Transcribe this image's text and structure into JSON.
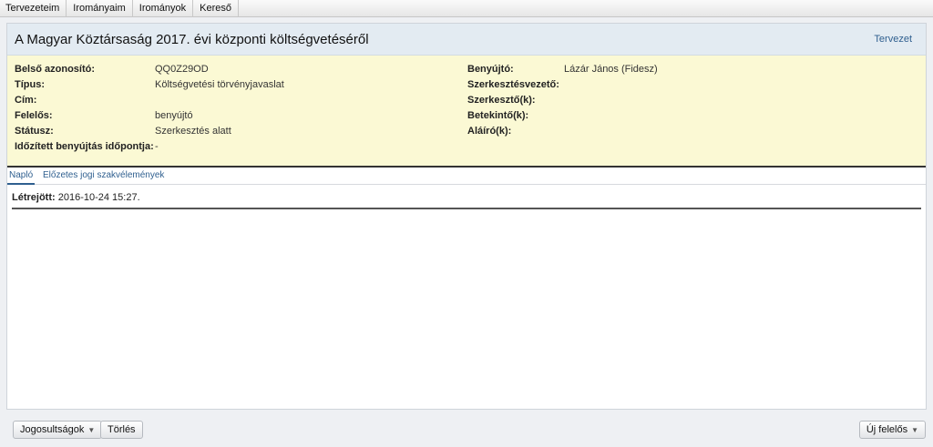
{
  "menu": {
    "items": [
      "Tervezeteim",
      "Irományaim",
      "Irományok",
      "Kereső"
    ]
  },
  "document": {
    "title": "A Magyar Köztársaság 2017. évi központi költségvetéséről",
    "status_link": "Tervezet"
  },
  "info": {
    "left": [
      {
        "label": "Belső azonosító:",
        "value": "QQ0Z29OD"
      },
      {
        "label": "Típus:",
        "value": "Költségvetési törvényjavaslat"
      },
      {
        "label": "Cím:",
        "value": ""
      },
      {
        "label": "Felelős:",
        "value": "benyújtó"
      },
      {
        "label": "Státusz:",
        "value": "Szerkesztés alatt"
      },
      {
        "label": "Időzített benyújtás időpontja:",
        "value": "-"
      }
    ],
    "right": [
      {
        "label": "Benyújtó:",
        "value": "Lázár János (Fidesz)"
      },
      {
        "label": "Szerkesztésvezető:",
        "value": ""
      },
      {
        "label": "Szerkesztő(k):",
        "value": ""
      },
      {
        "label": "Betekintő(k):",
        "value": ""
      },
      {
        "label": "Aláíró(k):",
        "value": ""
      }
    ]
  },
  "tabs": [
    "Napló",
    "Előzetes jogi szakvélemények"
  ],
  "log": {
    "created_label": "Létrejött:",
    "created_value": "2016-10-24 15:27."
  },
  "footer": {
    "permissions_label": "Jogosultságok",
    "delete_label": "Törlés",
    "new_responsible_label": "Új felelős"
  }
}
